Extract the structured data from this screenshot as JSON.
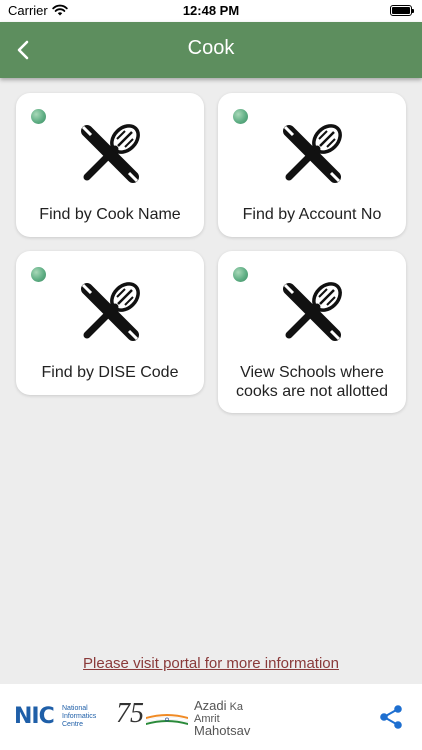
{
  "status_bar": {
    "carrier": "Carrier",
    "time": "12:48 PM",
    "wifi_icon": "wifi-icon",
    "battery_icon": "battery-full-icon"
  },
  "app_bar": {
    "title": "Cook",
    "back_icon": "chevron-left-icon",
    "background": "#5d8e5e"
  },
  "cards": [
    {
      "label": "Find by Cook Name",
      "icon": "cooking-utensils-icon"
    },
    {
      "label": "Find by Account No",
      "icon": "cooking-utensils-icon"
    },
    {
      "label": "Find by DISE Code",
      "icon": "cooking-utensils-icon"
    },
    {
      "label": "View Schools where cooks are not allotted",
      "icon": "cooking-utensils-icon"
    }
  ],
  "portal_link": "Please visit portal for more information",
  "footer": {
    "nic": {
      "abbr": "NIC",
      "line1": "National",
      "line2": "Informatics",
      "line3": "Centre"
    },
    "azadi": {
      "number": "75",
      "word1": "Azadi",
      "word2": "Ka",
      "word3": "Amrit",
      "word4": "Mahotsav"
    },
    "share_icon": "share-icon"
  },
  "colors": {
    "accent": "#5d8e5e",
    "link": "#8a3a3a",
    "background": "#ededed",
    "status_dot": "#5fae84"
  }
}
